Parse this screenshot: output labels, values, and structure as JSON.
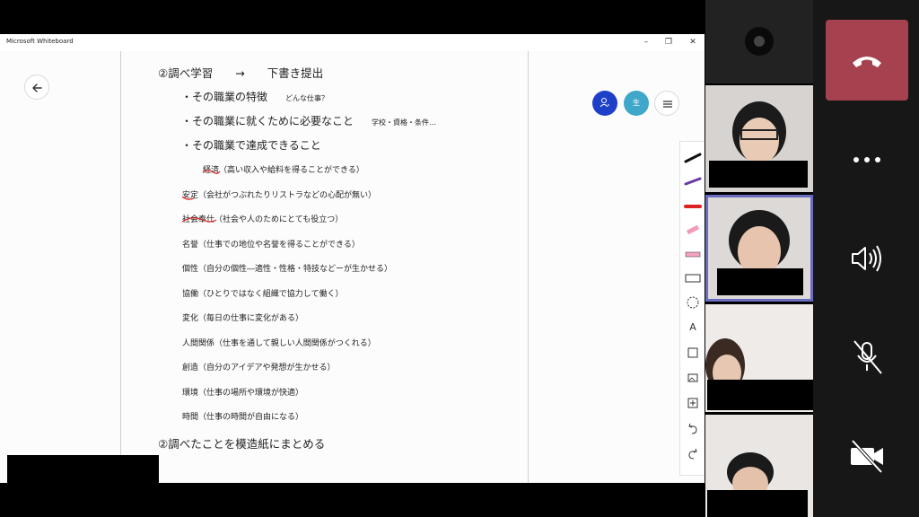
{
  "window": {
    "title": "Microsoft Whiteboard",
    "minimize": "–",
    "maximize": "❐",
    "close": "✕"
  },
  "board": {
    "heading1": "②調べ学習　　→　　下書き提出",
    "bullets": [
      {
        "text": "・その職業の特徴",
        "note": "どんな仕事？"
      },
      {
        "text": "・その職業に就くために必要なこと",
        "note": "学校・資格・条件…"
      },
      {
        "text": "・その職業で達成できること",
        "note": ""
      }
    ],
    "items": [
      "経済（高い収入や給料を得ることができる）",
      "安定（会社がつぶれたりリストラなどの心配が無い）",
      "社会奉仕（社会や人のためにとても役立つ）",
      "名誉（仕事での地位や名誉を得ることができる）",
      "個性（自分の個性―適性・性格・特技などーが生かせる）",
      "協働（ひとりではなく組織で協力して働く）",
      "変化（毎日の仕事に変化がある）",
      "人間関係（仕事を通して親しい人間関係がつくれる）",
      "創造（自分のアイデアや発想が生かせる）",
      "環境（仕事の場所や環境が快適）",
      "時間（仕事の時間が自由になる）"
    ],
    "heading2": "②調べたことを模造紙にまとめる"
  },
  "avatars": {
    "blue_label": "",
    "teal_label": "生"
  },
  "icons": {
    "back": "arrow-left-icon",
    "menu": "hamburger-icon",
    "text_tool": "A",
    "tools": [
      "pen-black",
      "pen-purple",
      "pen-red",
      "highlighter-pink",
      "pencil",
      "ruler",
      "lasso",
      "text",
      "note",
      "image",
      "insert",
      "undo",
      "redo"
    ]
  },
  "colors": {
    "avatar_blue": "#1e40c9",
    "avatar_teal": "#3fa7c9",
    "end_call": "#a6424f",
    "panel_bg": "#171717",
    "active_speaker_border": "#6b6bbf"
  },
  "call": {
    "participants": [
      "participant-1",
      "participant-2",
      "participant-3",
      "participant-4",
      "participant-5"
    ]
  }
}
